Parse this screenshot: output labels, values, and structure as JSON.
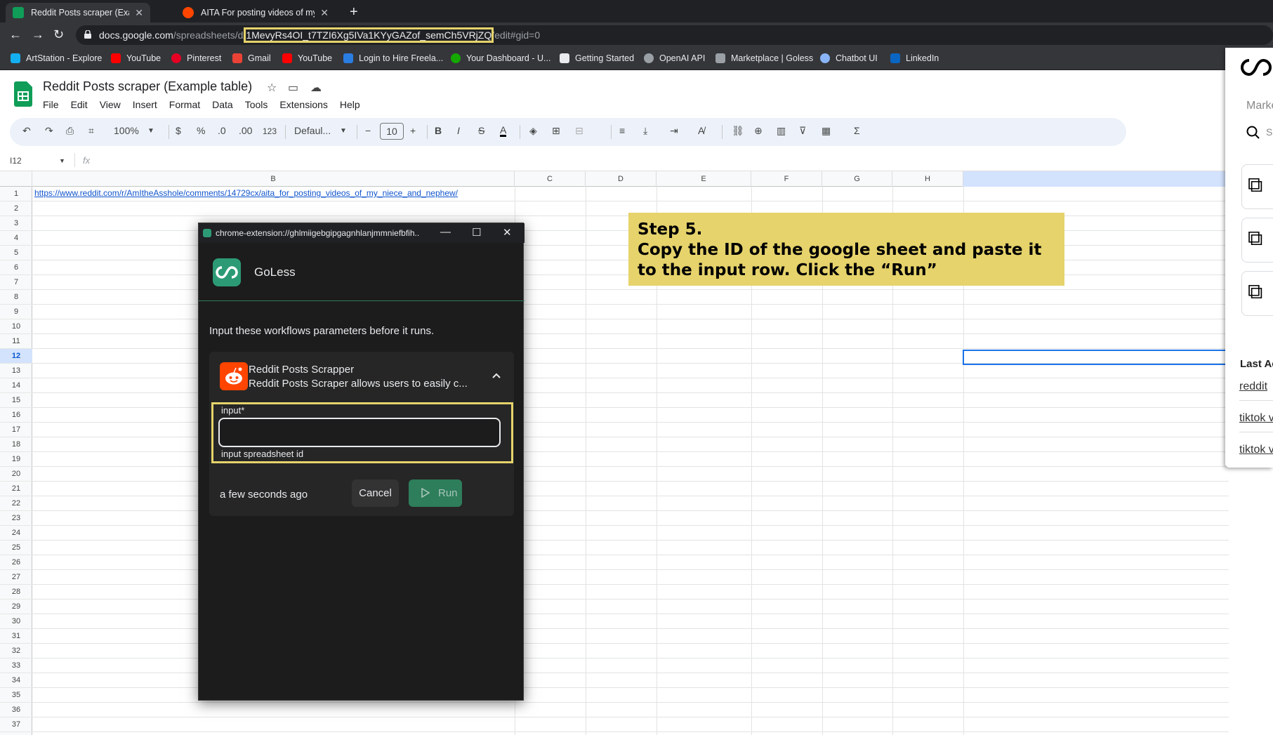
{
  "browser": {
    "tabs": [
      {
        "title": "Reddit Posts scraper (Example ta",
        "close": "✕"
      },
      {
        "title": "AITA For posting videos of my ni",
        "close": "✕"
      }
    ],
    "new_tab": "+",
    "url": {
      "host": "docs.google.com",
      "path": "/spreadsheets/d/",
      "sheet_id": "1MevyRs4OI_t7TZI6Xg5IVa1KYyGAZof_semCh5VRjZQ",
      "suffix": "/edit#gid=0"
    },
    "bookmarks": [
      {
        "label": "ArtStation - Explore",
        "color": "#13aff0"
      },
      {
        "label": "YouTube",
        "color": "#ff0000"
      },
      {
        "label": "Pinterest",
        "color": "#e60023"
      },
      {
        "label": "Gmail",
        "color": "#ea4335"
      },
      {
        "label": "YouTube",
        "color": "#ff0000"
      },
      {
        "label": "Login to Hire Freela...",
        "color": "#2a7de1"
      },
      {
        "label": "Your Dashboard - U...",
        "color": "#14a800"
      },
      {
        "label": "Getting Started",
        "color": "#e8eaed"
      },
      {
        "label": "OpenAI API",
        "color": "#9aa0a6"
      },
      {
        "label": "Marketplace | Goless",
        "color": "#9aa0a6"
      },
      {
        "label": "Chatbot UI",
        "color": "#8ab4f8"
      },
      {
        "label": "LinkedIn",
        "color": "#0a66c2"
      }
    ]
  },
  "sheets": {
    "title": "Reddit Posts scraper (Example table)",
    "menu": [
      "File",
      "Edit",
      "View",
      "Insert",
      "Format",
      "Data",
      "Tools",
      "Extensions",
      "Help"
    ],
    "toolbar": {
      "zoom": "100%",
      "currency": "$",
      "percent": "%",
      "dec_decrease": ".0",
      "dec_increase": ".00",
      "number_format": "123",
      "font": "Defaul...",
      "font_size": "10",
      "bold": "B",
      "italic": "I",
      "sigma": "Σ"
    },
    "name_box": "I12",
    "fx": "fx",
    "columns": [
      "B",
      "C",
      "D",
      "E",
      "F",
      "G",
      "H"
    ],
    "rows": [
      "1",
      "2",
      "3",
      "4",
      "5",
      "6",
      "7",
      "8",
      "9",
      "10",
      "11",
      "12",
      "13",
      "14",
      "15",
      "16",
      "17",
      "18",
      "19",
      "20",
      "21",
      "22",
      "23",
      "24",
      "25",
      "26",
      "27",
      "28",
      "29",
      "30",
      "31",
      "32",
      "33",
      "34",
      "35",
      "36",
      "37"
    ],
    "selected_row": "12",
    "cell_b1": "https://www.reddit.com/r/AmItheAsshole/comments/14729cx/aita_for_posting_videos_of_my_niece_and_nephew/"
  },
  "annotation": {
    "line1": "Step 5.",
    "line2": "Copy the ID of the google sheet and paste it",
    "line3": "to the input row. Click the “Run”"
  },
  "side_panel": {
    "marker": "Marke",
    "search_fragment": "S",
    "last_header": "Last Ac",
    "links": [
      "reddit",
      "tiktok v",
      "tiktok v"
    ]
  },
  "popup": {
    "window_title": "chrome-extension://ghlmiigebgipgagnhlanjmmniefbfih...",
    "app_name": "GoLess",
    "intro": "Input these workflows parameters before it runs.",
    "workflow_name": "Reddit Posts Scrapper",
    "workflow_desc": "Reddit Posts Scraper allows users to easily c...",
    "input_label": "input*",
    "input_value": "",
    "input_help": "input spreadsheet id",
    "timestamp": "a few seconds ago",
    "cancel_label": "Cancel",
    "run_label": "Run"
  }
}
